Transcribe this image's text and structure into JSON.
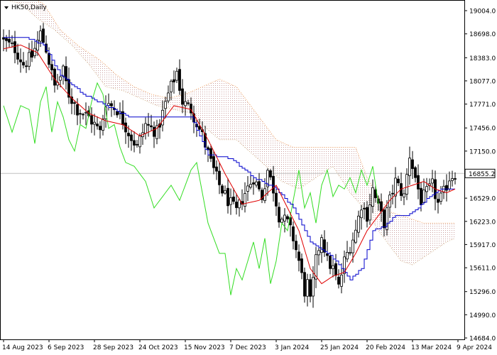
{
  "chart_data": {
    "type": "candlestick",
    "symbol_label": "HK50,Daily",
    "last_price": 16855.2,
    "last_price_label": "16855.2",
    "ylim": [
      14684.0,
      19004.0
    ],
    "y_ticks": [
      "19004.0",
      "18698.0",
      "18383.0",
      "18077.0",
      "17771.0",
      "17456.0",
      "17150.0",
      "16529.0",
      "16223.0",
      "15917.0",
      "15611.0",
      "15296.0",
      "14990.0",
      "14684.0"
    ],
    "x_ticks": [
      "14 Aug 2023",
      "6 Sep 2023",
      "28 Sep 2023",
      "24 Oct 2023",
      "15 Nov 2023",
      "7 Dec 2023",
      "3 Jan 2024",
      "25 Jan 2024",
      "20 Feb 2024",
      "13 Mar 2024",
      "9 Apr 2024"
    ],
    "x_tick_bars": [
      0,
      16,
      32,
      48,
      64,
      80,
      96,
      112,
      128,
      144,
      160
    ],
    "bar_count": 160,
    "colors": {
      "candle": "#000000",
      "tenkan": "#e00000",
      "kijun": "#0000cc",
      "chikou": "#33dd22",
      "senkou_a": "#d2b48c",
      "senkou_b": "#f4a460",
      "cloud": "#a05050",
      "grid_line": "#c0c0c0"
    },
    "series_keypoints": {
      "close": [
        [
          0,
          18600
        ],
        [
          4,
          18500
        ],
        [
          7,
          18300
        ],
        [
          10,
          18400
        ],
        [
          13,
          18700
        ],
        [
          15,
          18500
        ],
        [
          18,
          18000
        ],
        [
          21,
          18200
        ],
        [
          23,
          17900
        ],
        [
          26,
          17700
        ],
        [
          30,
          17600
        ],
        [
          34,
          17400
        ],
        [
          36,
          17800
        ],
        [
          40,
          17700
        ],
        [
          44,
          17400
        ],
        [
          47,
          17200
        ],
        [
          50,
          17500
        ],
        [
          54,
          17400
        ],
        [
          58,
          17900
        ],
        [
          61,
          18200
        ],
        [
          63,
          17800
        ],
        [
          66,
          17700
        ],
        [
          70,
          17350
        ],
        [
          73,
          17000
        ],
        [
          76,
          16700
        ],
        [
          79,
          16500
        ],
        [
          82,
          16350
        ],
        [
          85,
          16600
        ],
        [
          88,
          16800
        ],
        [
          91,
          16550
        ],
        [
          93,
          16900
        ],
        [
          95,
          16650
        ],
        [
          97,
          16300
        ],
        [
          100,
          16200
        ],
        [
          102,
          16000
        ],
        [
          104,
          15700
        ],
        [
          106,
          15300
        ],
        [
          107,
          15400
        ],
        [
          108,
          15150
        ],
        [
          110,
          15700
        ],
        [
          112,
          16050
        ],
        [
          114,
          15700
        ],
        [
          116,
          15600
        ],
        [
          118,
          15350
        ],
        [
          120,
          15700
        ],
        [
          122,
          15900
        ],
        [
          124,
          16100
        ],
        [
          126,
          16450
        ],
        [
          128,
          16300
        ],
        [
          130,
          16650
        ],
        [
          132,
          16400
        ],
        [
          134,
          16200
        ],
        [
          136,
          16500
        ],
        [
          138,
          16750
        ],
        [
          141,
          16550
        ],
        [
          143,
          17100
        ],
        [
          145,
          16800
        ],
        [
          147,
          16500
        ],
        [
          149,
          16600
        ],
        [
          151,
          16700
        ],
        [
          153,
          16450
        ],
        [
          155,
          16600
        ],
        [
          157,
          16800
        ],
        [
          159,
          16855
        ]
      ],
      "tenkan": [
        [
          0,
          18500
        ],
        [
          6,
          18550
        ],
        [
          12,
          18450
        ],
        [
          18,
          18100
        ],
        [
          24,
          17850
        ],
        [
          30,
          17650
        ],
        [
          36,
          17550
        ],
        [
          42,
          17500
        ],
        [
          48,
          17350
        ],
        [
          54,
          17450
        ],
        [
          60,
          17750
        ],
        [
          66,
          17700
        ],
        [
          72,
          17300
        ],
        [
          78,
          16850
        ],
        [
          84,
          16450
        ],
        [
          90,
          16500
        ],
        [
          96,
          16700
        ],
        [
          100,
          16400
        ],
        [
          104,
          16100
        ],
        [
          108,
          15600
        ],
        [
          112,
          15400
        ],
        [
          116,
          15500
        ],
        [
          120,
          15550
        ],
        [
          124,
          15800
        ],
        [
          128,
          16100
        ],
        [
          132,
          16300
        ],
        [
          136,
          16500
        ],
        [
          140,
          16650
        ],
        [
          144,
          16700
        ],
        [
          148,
          16750
        ],
        [
          152,
          16650
        ],
        [
          156,
          16600
        ],
        [
          159,
          16650
        ]
      ],
      "kijun": [
        [
          0,
          18650
        ],
        [
          8,
          18650
        ],
        [
          14,
          18550
        ],
        [
          20,
          18150
        ],
        [
          28,
          17900
        ],
        [
          36,
          17750
        ],
        [
          44,
          17600
        ],
        [
          52,
          17600
        ],
        [
          60,
          17600
        ],
        [
          66,
          17600
        ],
        [
          72,
          17100
        ],
        [
          80,
          17050
        ],
        [
          88,
          16800
        ],
        [
          96,
          16650
        ],
        [
          102,
          16400
        ],
        [
          108,
          15950
        ],
        [
          114,
          15800
        ],
        [
          118,
          15650
        ],
        [
          122,
          15450
        ],
        [
          126,
          15600
        ],
        [
          130,
          16100
        ],
        [
          134,
          16150
        ],
        [
          138,
          16300
        ],
        [
          142,
          16300
        ],
        [
          146,
          16400
        ],
        [
          150,
          16550
        ],
        [
          154,
          16650
        ],
        [
          159,
          16650
        ]
      ],
      "chikou": [
        [
          0,
          17750
        ],
        [
          3,
          17400
        ],
        [
          6,
          17750
        ],
        [
          9,
          17700
        ],
        [
          11,
          17250
        ],
        [
          13,
          17800
        ],
        [
          15,
          18000
        ],
        [
          17,
          17400
        ],
        [
          19,
          17800
        ],
        [
          21,
          17600
        ],
        [
          23,
          17300
        ],
        [
          25,
          17150
        ],
        [
          27,
          17500
        ],
        [
          29,
          17450
        ],
        [
          31,
          17800
        ],
        [
          33,
          18050
        ],
        [
          35,
          17900
        ],
        [
          37,
          17450
        ],
        [
          39,
          17500
        ],
        [
          41,
          17200
        ],
        [
          43,
          17000
        ],
        [
          46,
          16950
        ],
        [
          50,
          16750
        ],
        [
          53,
          16400
        ],
        [
          56,
          16550
        ],
        [
          59,
          16700
        ],
        [
          62,
          16500
        ],
        [
          66,
          16900
        ],
        [
          68,
          17000
        ],
        [
          70,
          16600
        ],
        [
          72,
          16200
        ],
        [
          74,
          16000
        ],
        [
          76,
          15800
        ],
        [
          78,
          15800
        ],
        [
          80,
          15250
        ],
        [
          82,
          15600
        ],
        [
          84,
          15450
        ],
        [
          86,
          15700
        ],
        [
          88,
          15950
        ],
        [
          90,
          15600
        ],
        [
          92,
          16000
        ],
        [
          94,
          15400
        ],
        [
          96,
          15700
        ],
        [
          98,
          16200
        ],
        [
          100,
          16100
        ],
        [
          102,
          16500
        ],
        [
          104,
          16900
        ],
        [
          106,
          16400
        ],
        [
          108,
          16600
        ],
        [
          110,
          16200
        ],
        [
          112,
          16700
        ],
        [
          114,
          16900
        ],
        [
          116,
          16550
        ],
        [
          118,
          16700
        ],
        [
          120,
          16650
        ],
        [
          122,
          16800
        ],
        [
          124,
          16600
        ],
        [
          126,
          16900
        ],
        [
          128,
          16700
        ],
        [
          130,
          16950
        ],
        [
          132,
          16450
        ]
      ],
      "senkou_a": [
        [
          0,
          19150
        ],
        [
          6,
          19100
        ],
        [
          12,
          18900
        ],
        [
          18,
          18750
        ],
        [
          24,
          18550
        ],
        [
          30,
          18300
        ],
        [
          36,
          18000
        ],
        [
          42,
          17950
        ],
        [
          48,
          17850
        ],
        [
          54,
          17750
        ],
        [
          60,
          17700
        ],
        [
          66,
          17650
        ],
        [
          70,
          17500
        ],
        [
          76,
          17300
        ],
        [
          82,
          17300
        ],
        [
          88,
          17100
        ],
        [
          94,
          16900
        ],
        [
          98,
          16750
        ],
        [
          104,
          16650
        ],
        [
          110,
          16800
        ],
        [
          116,
          16950
        ],
        [
          122,
          16600
        ],
        [
          128,
          16350
        ],
        [
          132,
          16100
        ],
        [
          136,
          15900
        ],
        [
          140,
          15700
        ],
        [
          144,
          15650
        ],
        [
          148,
          15750
        ],
        [
          152,
          15850
        ],
        [
          156,
          15950
        ],
        [
          159,
          16000
        ]
      ],
      "senkou_b": [
        [
          0,
          19250
        ],
        [
          8,
          19200
        ],
        [
          14,
          19100
        ],
        [
          20,
          18750
        ],
        [
          26,
          18550
        ],
        [
          34,
          18350
        ],
        [
          40,
          18150
        ],
        [
          46,
          18000
        ],
        [
          52,
          17900
        ],
        [
          58,
          17850
        ],
        [
          64,
          17900
        ],
        [
          70,
          18000
        ],
        [
          76,
          18100
        ],
        [
          82,
          18000
        ],
        [
          90,
          17600
        ],
        [
          96,
          17300
        ],
        [
          102,
          17200
        ],
        [
          110,
          17200
        ],
        [
          118,
          17200
        ],
        [
          124,
          17200
        ],
        [
          128,
          16800
        ],
        [
          132,
          16550
        ],
        [
          136,
          16350
        ],
        [
          140,
          16300
        ],
        [
          144,
          16250
        ],
        [
          148,
          16200
        ],
        [
          152,
          16200
        ],
        [
          156,
          16200
        ],
        [
          159,
          16200
        ]
      ]
    }
  }
}
